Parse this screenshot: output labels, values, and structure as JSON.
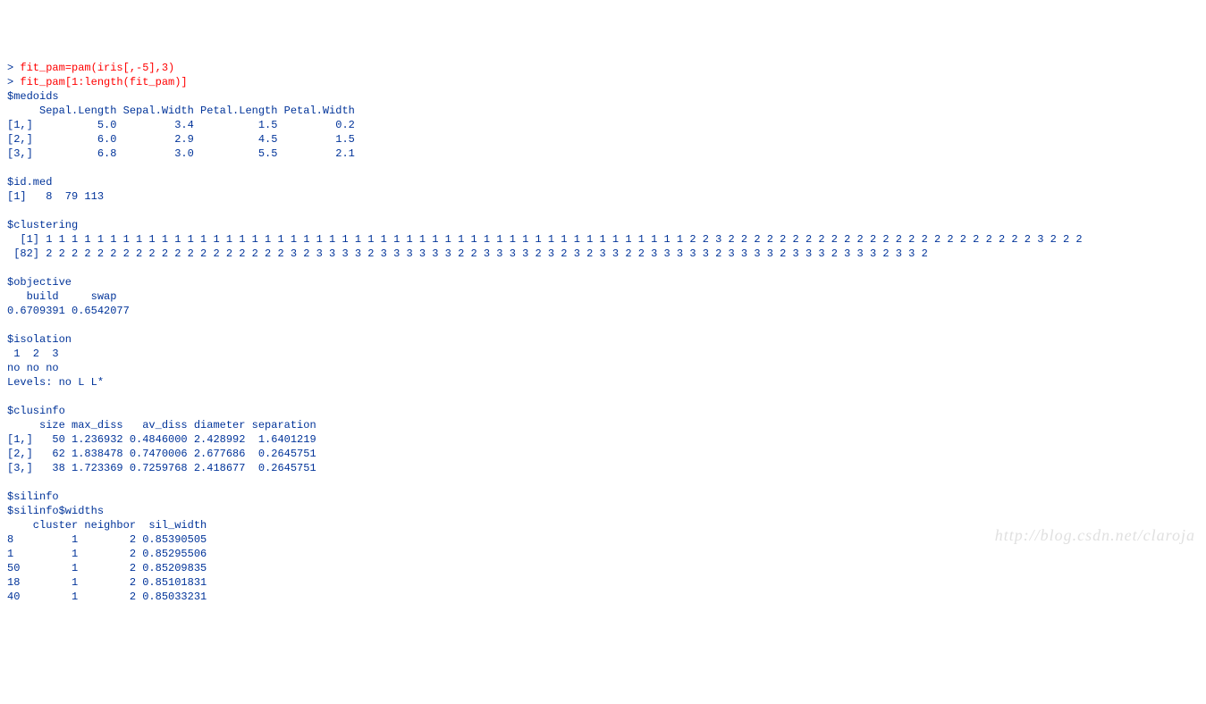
{
  "commands": [
    {
      "prompt": "> ",
      "text": "fit_pam=pam(iris[,-5],3)"
    },
    {
      "prompt": "> ",
      "text": "fit_pam[1:length(fit_pam)]"
    }
  ],
  "medoids": {
    "header": "$medoids",
    "colHeader": "     Sepal.Length Sepal.Width Petal.Length Petal.Width",
    "rows": [
      "[1,]          5.0         3.4          1.5         0.2",
      "[2,]          6.0         2.9          4.5         1.5",
      "[3,]          6.8         3.0          5.5         2.1"
    ]
  },
  "id_med": {
    "header": "$id.med",
    "line": "[1]   8  79 113"
  },
  "clustering": {
    "header": "$clustering",
    "lines": [
      "  [1] 1 1 1 1 1 1 1 1 1 1 1 1 1 1 1 1 1 1 1 1 1 1 1 1 1 1 1 1 1 1 1 1 1 1 1 1 1 1 1 1 1 1 1 1 1 1 1 1 1 1 2 2 3 2 2 2 2 2 2 2 2 2 2 2 2 2 2 2 2 2 2 2 2 2 2 2 2 3 2 2 2",
      " [82] 2 2 2 2 2 2 2 2 2 2 2 2 2 2 2 2 2 2 2 3 2 3 3 3 3 2 3 3 3 3 3 3 2 2 3 3 3 3 2 3 2 3 2 3 3 2 2 3 3 3 3 3 2 3 3 3 3 2 3 3 3 2 3 3 3 2 3 3 2"
    ]
  },
  "objective": {
    "header": "$objective",
    "labels": "   build     swap ",
    "values": "0.6709391 0.6542077 "
  },
  "isolation": {
    "header": "$isolation",
    "labels": " 1  2  3 ",
    "values": "no no no ",
    "levels": "Levels: no L L*"
  },
  "clusinfo": {
    "header": "$clusinfo",
    "colHeader": "     size max_diss   av_diss diameter separation",
    "rows": [
      "[1,]   50 1.236932 0.4846000 2.428992  1.6401219",
      "[2,]   62 1.838478 0.7470006 2.677686  0.2645751",
      "[3,]   38 1.723369 0.7259768 2.418677  0.2645751"
    ]
  },
  "silinfo": {
    "header": "$silinfo",
    "widthsHeader": "$silinfo$widths",
    "colHeader": "    cluster neighbor  sil_width",
    "rows": [
      "8         1        2 0.85390505",
      "1         1        2 0.85295506",
      "50        1        2 0.85209835",
      "18        1        2 0.85101831",
      "40        1        2 0.85033231"
    ]
  },
  "watermark": "http://blog.csdn.net/claroja"
}
